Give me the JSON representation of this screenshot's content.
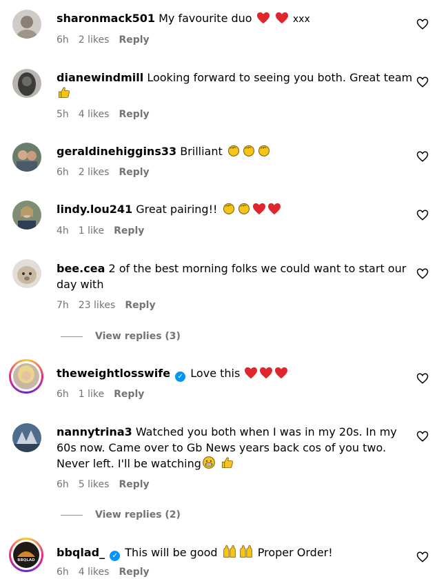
{
  "comments": [
    {
      "user": "sharonmack501",
      "text": "My favourite duo",
      "emojis_after": [
        "heart",
        "heart"
      ],
      "extra": "xxx",
      "time": "6h",
      "likes": "2 likes",
      "reply": "Reply",
      "avatar": {
        "bg": "#cfcbc6",
        "fg": "#8a7f76"
      }
    },
    {
      "user": "dianewindmill",
      "text": "Looking forward to seeing you both. Great team",
      "emojis_after": [
        "thumbs-up"
      ],
      "time": "5h",
      "likes": "4 likes",
      "reply": "Reply",
      "avatar": {
        "bg": "#3b3b38",
        "fg": "#6b6b66"
      }
    },
    {
      "user": "geraldinehiggins33",
      "text": "Brilliant",
      "emojis_after": [
        "clap",
        "clap",
        "clap"
      ],
      "time": "6h",
      "likes": "2 likes",
      "reply": "Reply",
      "avatar": {
        "bg": "#6a7d6b",
        "fg": "#d2a98a"
      }
    },
    {
      "user": "lindy.lou241",
      "text": "Great pairing!!",
      "emojis_after": [
        "clap",
        "clap",
        "heart",
        "heart"
      ],
      "time": "4h",
      "likes": "1 like",
      "reply": "Reply",
      "avatar": {
        "bg": "#7e8d73",
        "fg": "#2c3d55"
      }
    },
    {
      "user": "bee.cea",
      "text": "2 of the best morning folks we could want to start our day with",
      "time": "7h",
      "likes": "23 likes",
      "reply": "Reply",
      "avatar": {
        "bg": "#e2ddd6",
        "fg": "#8c7c6a"
      }
    },
    {
      "user": "theweightlosswife",
      "verified": true,
      "text": "Love this",
      "emojis_after": [
        "heart",
        "heart",
        "heart"
      ],
      "time": "6h",
      "likes": "1 like",
      "reply": "Reply",
      "avatar": {
        "bg": "#c9b7a6",
        "fg": "#e8d68a"
      }
    },
    {
      "user": "nannytrina3",
      "text": "Watched you both when I was in my 20s. In my 60s now. Came over to Gb News years back cos of you two. Never left. I'll be watching",
      "emojis_after": [
        "grin",
        "thumbs-up"
      ],
      "time": "6h",
      "likes": "5 likes",
      "reply": "Reply",
      "avatar": {
        "bg": "#4e6d8c",
        "fg": "#c9d3dd"
      }
    },
    {
      "user": "bbqlad_",
      "verified": true,
      "text": "This will be good",
      "emojis_after": [
        "raised-hands",
        "raised-hands"
      ],
      "extra": "Proper Order!",
      "time": "6h",
      "likes": "4 likes",
      "reply": "Reply",
      "avatar": {
        "bg": "#1f1a14",
        "fg": "#d9862b",
        "logo_text": "BBQLAD"
      }
    }
  ],
  "view_replies": [
    {
      "label": "View replies (3)"
    },
    {
      "label": "View replies (2)"
    }
  ],
  "colors": {
    "heart": "#e0262d",
    "accent": "#0095f6",
    "muted": "#737373"
  }
}
